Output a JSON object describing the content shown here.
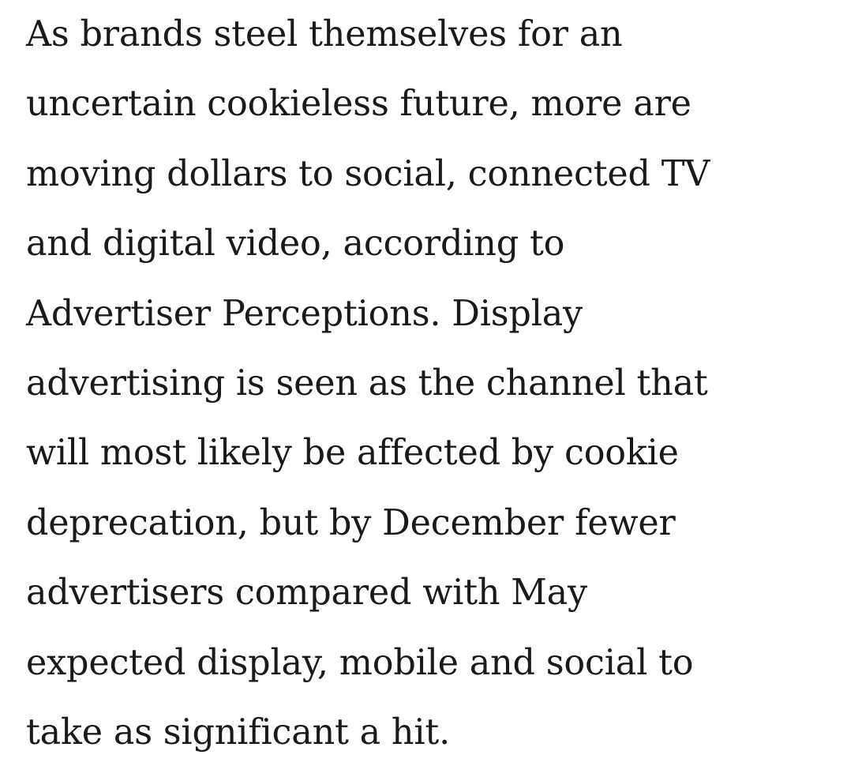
{
  "article": {
    "paragraph_lines": [
      "As brands steel themselves for an",
      "uncertain cookieless future, more are",
      "moving dollars to social, connected TV",
      "and digital video, according to",
      "Advertiser Perceptions. Display",
      "advertising is seen as the channel that",
      "will most likely be affected by cookie",
      "deprecation, but by December fewer",
      "advertisers compared with May",
      "expected display, mobile and social to",
      "take as significant a hit."
    ]
  }
}
